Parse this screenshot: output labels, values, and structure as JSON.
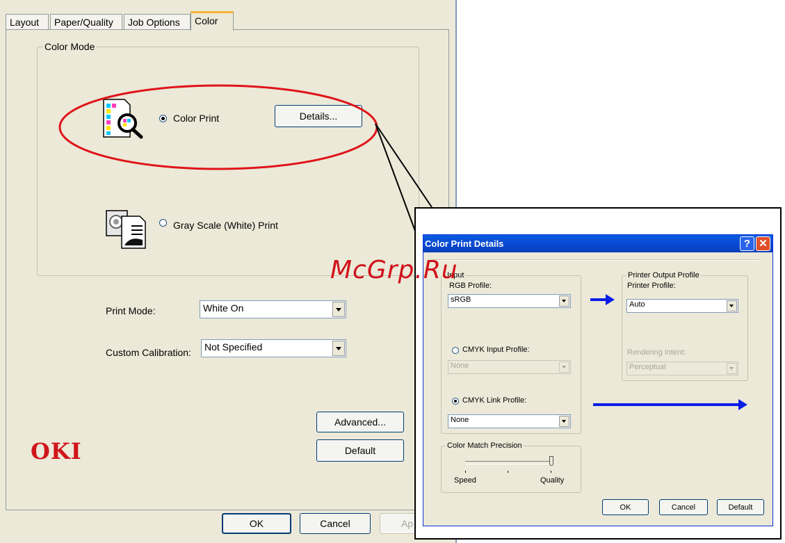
{
  "tabs": [
    {
      "label": "Layout"
    },
    {
      "label": "Paper/Quality"
    },
    {
      "label": "Job Options"
    },
    {
      "label": "Color"
    }
  ],
  "color_mode": {
    "group_label": "Color Mode",
    "color_print_label": "Color Print",
    "details_button": "Details...",
    "grayscale_label": "Gray Scale (White) Print"
  },
  "print_mode": {
    "label": "Print Mode:",
    "value": "White On"
  },
  "custom_calibration": {
    "label": "Custom Calibration:",
    "value": "Not Specified"
  },
  "buttons": {
    "advanced": "Advanced...",
    "default": "Default",
    "ok": "OK",
    "cancel": "Cancel",
    "apply_partial": "Ap"
  },
  "logo_text": "OKI",
  "watermark": "McGrp.Ru",
  "dialog": {
    "title": "Color Print Details",
    "help_glyph": "?",
    "close_glyph": "✕",
    "input_group_label": "Input",
    "rgb_profile_label": "RGB Profile:",
    "rgb_profile_value": "sRGB",
    "cmyk_input_label": "CMYK Input Profile:",
    "cmyk_input_value": "None",
    "cmyk_link_label": "CMYK Link Profile:",
    "cmyk_link_value": "None",
    "output_group_label": "Printer Output Profile",
    "printer_profile_label": "Printer Profile:",
    "printer_profile_value": "Auto",
    "rendering_intent_label": "Rendering Intent:",
    "rendering_intent_value": "Perceptual",
    "precision_group_label": "Color Match Precision",
    "speed_label": "Speed",
    "quality_label": "Quality",
    "precision_level": 1.0,
    "ok": "OK",
    "cancel": "Cancel",
    "default": "Default"
  },
  "colors": {
    "annotation_red": "#e0141a",
    "arrow_blue": "#0a1ee6",
    "logo_red": "#d0151b"
  }
}
